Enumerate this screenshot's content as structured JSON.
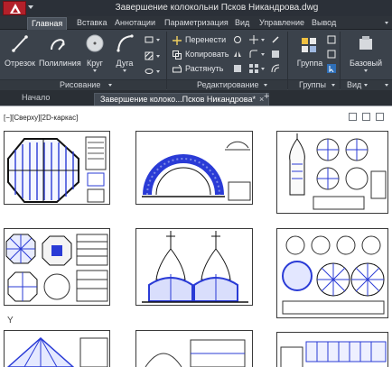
{
  "window": {
    "title": "Завершение колокольни Псков Никандрова.dwg"
  },
  "ribbon_tabs": [
    {
      "label": "Главная",
      "active": true
    },
    {
      "label": "Вставка",
      "active": false
    },
    {
      "label": "Аннотации",
      "active": false
    },
    {
      "label": "Параметризация",
      "active": false
    },
    {
      "label": "Вид",
      "active": false
    },
    {
      "label": "Управление",
      "active": false
    },
    {
      "label": "Вывод",
      "active": false
    }
  ],
  "draw_panel": {
    "title": "Рисование",
    "tools": [
      {
        "label": "Отрезок",
        "icon": "line-icon"
      },
      {
        "label": "Полилиния",
        "icon": "polyline-icon"
      },
      {
        "label": "Круг",
        "icon": "circle-icon"
      },
      {
        "label": "Дуга",
        "icon": "arc-icon"
      }
    ]
  },
  "modify_panel": {
    "title": "Редактирование",
    "tools": [
      {
        "label": "Перенести",
        "icon": "move-icon"
      },
      {
        "label": "Копировать",
        "icon": "copy-icon"
      },
      {
        "label": "Растянуть",
        "icon": "stretch-icon"
      }
    ]
  },
  "groups_panel": {
    "title": "Группы",
    "tool": {
      "label": "Группа",
      "icon": "group-icon"
    }
  },
  "view_panel": {
    "title": "Вид",
    "tool": {
      "label": "Базовый",
      "icon": "base-view-icon"
    }
  },
  "file_tabs": [
    {
      "label": "Начало",
      "active": false
    },
    {
      "label": "Завершение колоко...Псков Никандрова*",
      "active": true,
      "close": "×"
    }
  ],
  "file_tab_add": "+",
  "viewport": {
    "label": "[−][Сверху][2D-каркас]",
    "ucs_axis": "Y"
  },
  "colors": {
    "accent_red": "#b3202a",
    "ribbon_bg": "#3b424b",
    "drawing_blue": "#2a3bd6"
  }
}
